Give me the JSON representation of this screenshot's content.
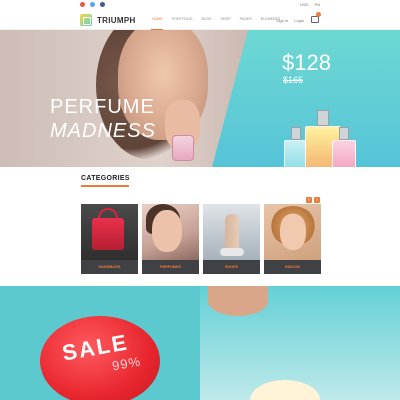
{
  "topbar": {
    "social_icons": [
      "google-plus-icon",
      "twitter-icon",
      "facebook-icon"
    ],
    "phone": "",
    "language": "USD",
    "currency": "EN"
  },
  "header": {
    "logo_text": "TRIUMPH",
    "nav": [
      {
        "label": "HOME",
        "active": true
      },
      {
        "label": "PORTFOLIO",
        "active": false
      },
      {
        "label": "BLOG",
        "active": false
      },
      {
        "label": "SHOP",
        "active": false
      },
      {
        "label": "PAGES",
        "active": false
      },
      {
        "label": "ELEMENTS",
        "active": false
      }
    ],
    "account_label": "Sign in",
    "login_label": "Login",
    "cart_count": "1",
    "accent": "#f07a3a"
  },
  "hero": {
    "title_line1": "PERFUME",
    "title_line2": "MADNESS",
    "price": "$128",
    "old_price": "$165",
    "teal": "#5cc9d6"
  },
  "categories": {
    "title": "CATEGORIES",
    "subtitle": "",
    "prev": "‹",
    "next": "›",
    "items": [
      {
        "label": "HANDBAGS"
      },
      {
        "label": "PERFUMES"
      },
      {
        "label": "SHOES"
      },
      {
        "label": "INDOOR"
      }
    ]
  },
  "sale": {
    "label": "SALE",
    "percent": "99%",
    "bubble_color": "#e8262e"
  }
}
